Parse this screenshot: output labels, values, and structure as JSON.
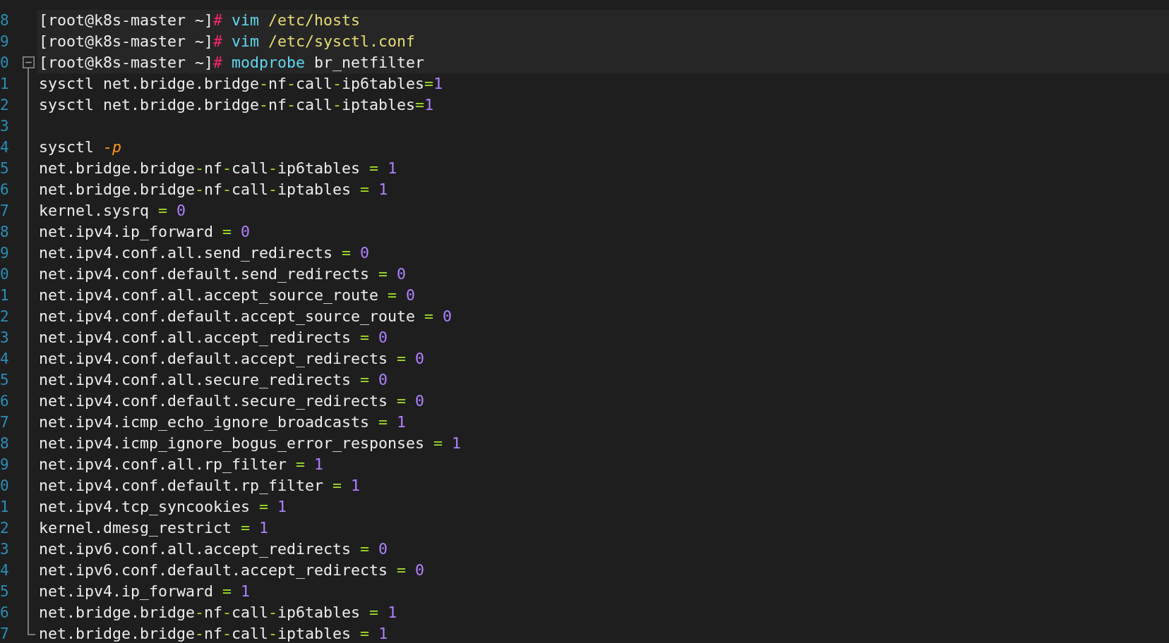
{
  "editor": {
    "lines": [
      {
        "number": "8",
        "highlighted": true,
        "segments": [
          {
            "kind": "plain",
            "text": "[root@k8s-master ~]"
          },
          {
            "kind": "prompt",
            "text": "#"
          },
          {
            "kind": "command",
            "text": " vim"
          },
          {
            "kind": "path",
            "text": " /etc/hosts"
          }
        ]
      },
      {
        "number": "9",
        "highlighted": true,
        "segments": [
          {
            "kind": "plain",
            "text": "[root@k8s-master ~]"
          },
          {
            "kind": "prompt",
            "text": "#"
          },
          {
            "kind": "command",
            "text": " vim"
          },
          {
            "kind": "path",
            "text": " /etc/sysctl.conf"
          }
        ]
      },
      {
        "number": "0",
        "highlighted": true,
        "expanded": true,
        "segments": [
          {
            "kind": "plain",
            "text": "[root@k8s-master ~]"
          },
          {
            "kind": "prompt",
            "text": "#"
          },
          {
            "kind": "command",
            "text": " modprobe"
          },
          {
            "kind": "plain",
            "text": " br_netfilter"
          }
        ],
        "children": [
          {
            "number": "1",
            "highlighted": false,
            "segments": [
              {
                "kind": "plain",
                "text": "sysctl net.bridge.bridge"
              },
              {
                "kind": "operator",
                "text": "-"
              },
              {
                "kind": "plain",
                "text": "nf"
              },
              {
                "kind": "operator",
                "text": "-"
              },
              {
                "kind": "plain",
                "text": "call"
              },
              {
                "kind": "operator",
                "text": "-"
              },
              {
                "kind": "plain",
                "text": "ip6tables"
              },
              {
                "kind": "operator",
                "text": "="
              },
              {
                "kind": "number",
                "text": "1"
              }
            ]
          },
          {
            "number": "2",
            "highlighted": false,
            "segments": [
              {
                "kind": "plain",
                "text": "sysctl net.bridge.bridge"
              },
              {
                "kind": "operator",
                "text": "-"
              },
              {
                "kind": "plain",
                "text": "nf"
              },
              {
                "kind": "operator",
                "text": "-"
              },
              {
                "kind": "plain",
                "text": "call"
              },
              {
                "kind": "operator",
                "text": "-"
              },
              {
                "kind": "plain",
                "text": "iptables"
              },
              {
                "kind": "operator",
                "text": "="
              },
              {
                "kind": "number",
                "text": "1"
              }
            ]
          },
          {
            "number": "3",
            "highlighted": false
          },
          {
            "number": "4",
            "highlighted": false,
            "segments": [
              {
                "kind": "plain",
                "text": "sysctl "
              },
              {
                "kind": "flag",
                "text": "-p"
              }
            ]
          },
          {
            "number": "5",
            "highlighted": false,
            "segments": [
              {
                "kind": "plain",
                "text": "net.bridge.bridge"
              },
              {
                "kind": "operator",
                "text": "-"
              },
              {
                "kind": "plain",
                "text": "nf"
              },
              {
                "kind": "operator",
                "text": "-"
              },
              {
                "kind": "plain",
                "text": "call"
              },
              {
                "kind": "operator",
                "text": "-"
              },
              {
                "kind": "plain",
                "text": "ip6tables "
              },
              {
                "kind": "operator",
                "text": "="
              },
              {
                "kind": "number",
                "text": " 1"
              }
            ]
          },
          {
            "number": "6",
            "highlighted": false,
            "segments": [
              {
                "kind": "plain",
                "text": "net.bridge.bridge"
              },
              {
                "kind": "operator",
                "text": "-"
              },
              {
                "kind": "plain",
                "text": "nf"
              },
              {
                "kind": "operator",
                "text": "-"
              },
              {
                "kind": "plain",
                "text": "call"
              },
              {
                "kind": "operator",
                "text": "-"
              },
              {
                "kind": "plain",
                "text": "iptables "
              },
              {
                "kind": "operator",
                "text": "="
              },
              {
                "kind": "number",
                "text": " 1"
              }
            ]
          },
          {
            "number": "7",
            "highlighted": false,
            "segments": [
              {
                "kind": "plain",
                "text": "kernel.sysrq "
              },
              {
                "kind": "operator",
                "text": "="
              },
              {
                "kind": "number",
                "text": " 0"
              }
            ]
          },
          {
            "number": "8",
            "highlighted": false,
            "segments": [
              {
                "kind": "plain",
                "text": "net.ipv4.ip_forward "
              },
              {
                "kind": "operator",
                "text": "="
              },
              {
                "kind": "number",
                "text": " 0"
              }
            ]
          },
          {
            "number": "9",
            "highlighted": false,
            "segments": [
              {
                "kind": "plain",
                "text": "net.ipv4.conf.all.send_redirects "
              },
              {
                "kind": "operator",
                "text": "="
              },
              {
                "kind": "number",
                "text": " 0"
              }
            ]
          },
          {
            "number": "0",
            "highlighted": false,
            "segments": [
              {
                "kind": "plain",
                "text": "net.ipv4.conf.default.send_redirects "
              },
              {
                "kind": "operator",
                "text": "="
              },
              {
                "kind": "number",
                "text": " 0"
              }
            ]
          },
          {
            "number": "1",
            "highlighted": false,
            "segments": [
              {
                "kind": "plain",
                "text": "net.ipv4.conf.all.accept_source_route "
              },
              {
                "kind": "operator",
                "text": "="
              },
              {
                "kind": "number",
                "text": " 0"
              }
            ]
          },
          {
            "number": "2",
            "highlighted": false,
            "segments": [
              {
                "kind": "plain",
                "text": "net.ipv4.conf.default.accept_source_route "
              },
              {
                "kind": "operator",
                "text": "="
              },
              {
                "kind": "number",
                "text": " 0"
              }
            ]
          },
          {
            "number": "3",
            "highlighted": false,
            "segments": [
              {
                "kind": "plain",
                "text": "net.ipv4.conf.all.accept_redirects "
              },
              {
                "kind": "operator",
                "text": "="
              },
              {
                "kind": "number",
                "text": " 0"
              }
            ]
          },
          {
            "number": "4",
            "highlighted": false,
            "segments": [
              {
                "kind": "plain",
                "text": "net.ipv4.conf.default.accept_redirects "
              },
              {
                "kind": "operator",
                "text": "="
              },
              {
                "kind": "number",
                "text": " 0"
              }
            ]
          },
          {
            "number": "5",
            "highlighted": false,
            "segments": [
              {
                "kind": "plain",
                "text": "net.ipv4.conf.all.secure_redirects "
              },
              {
                "kind": "operator",
                "text": "="
              },
              {
                "kind": "number",
                "text": " 0"
              }
            ]
          },
          {
            "number": "6",
            "highlighted": false,
            "segments": [
              {
                "kind": "plain",
                "text": "net.ipv4.conf.default.secure_redirects "
              },
              {
                "kind": "operator",
                "text": "="
              },
              {
                "kind": "number",
                "text": " 0"
              }
            ]
          },
          {
            "number": "7",
            "highlighted": false,
            "segments": [
              {
                "kind": "plain",
                "text": "net.ipv4.icmp_echo_ignore_broadcasts "
              },
              {
                "kind": "operator",
                "text": "="
              },
              {
                "kind": "number",
                "text": " 1"
              }
            ]
          },
          {
            "number": "8",
            "highlighted": false,
            "segments": [
              {
                "kind": "plain",
                "text": "net.ipv4.icmp_ignore_bogus_error_responses "
              },
              {
                "kind": "operator",
                "text": "="
              },
              {
                "kind": "number",
                "text": " 1"
              }
            ]
          },
          {
            "number": "9",
            "highlighted": false,
            "segments": [
              {
                "kind": "plain",
                "text": "net.ipv4.conf.all.rp_filter "
              },
              {
                "kind": "operator",
                "text": "="
              },
              {
                "kind": "number",
                "text": " 1"
              }
            ]
          },
          {
            "number": "0",
            "highlighted": false,
            "segments": [
              {
                "kind": "plain",
                "text": "net.ipv4.conf.default.rp_filter "
              },
              {
                "kind": "operator",
                "text": "="
              },
              {
                "kind": "number",
                "text": " 1"
              }
            ]
          },
          {
            "number": "1",
            "highlighted": false,
            "segments": [
              {
                "kind": "plain",
                "text": "net.ipv4.tcp_syncookies "
              },
              {
                "kind": "operator",
                "text": "="
              },
              {
                "kind": "number",
                "text": " 1"
              }
            ]
          },
          {
            "number": "2",
            "highlighted": false,
            "segments": [
              {
                "kind": "plain",
                "text": "kernel.dmesg_restrict "
              },
              {
                "kind": "operator",
                "text": "="
              },
              {
                "kind": "number",
                "text": " 1"
              }
            ]
          },
          {
            "number": "3",
            "highlighted": false,
            "segments": [
              {
                "kind": "plain",
                "text": "net.ipv6.conf.all.accept_redirects "
              },
              {
                "kind": "operator",
                "text": "="
              },
              {
                "kind": "number",
                "text": " 0"
              }
            ]
          },
          {
            "number": "4",
            "highlighted": false,
            "segments": [
              {
                "kind": "plain",
                "text": "net.ipv6.conf.default.accept_redirects "
              },
              {
                "kind": "operator",
                "text": "="
              },
              {
                "kind": "number",
                "text": " 0"
              }
            ]
          },
          {
            "number": "5",
            "highlighted": false,
            "segments": [
              {
                "kind": "plain",
                "text": "net.ipv4.ip_forward "
              },
              {
                "kind": "operator",
                "text": "="
              },
              {
                "kind": "number",
                "text": " 1"
              }
            ]
          },
          {
            "number": "6",
            "highlighted": false,
            "segments": [
              {
                "kind": "plain",
                "text": "net.bridge.bridge"
              },
              {
                "kind": "operator",
                "text": "-"
              },
              {
                "kind": "plain",
                "text": "nf"
              },
              {
                "kind": "operator",
                "text": "-"
              },
              {
                "kind": "plain",
                "text": "call"
              },
              {
                "kind": "operator",
                "text": "-"
              },
              {
                "kind": "plain",
                "text": "ip6tables "
              },
              {
                "kind": "operator",
                "text": "="
              },
              {
                "kind": "number",
                "text": " 1"
              }
            ]
          },
          {
            "number": "7",
            "highlighted": false,
            "segments": [
              {
                "kind": "plain",
                "text": "net.bridge.bridge"
              },
              {
                "kind": "operator",
                "text": "-"
              },
              {
                "kind": "plain",
                "text": "nf"
              },
              {
                "kind": "operator",
                "text": "-"
              },
              {
                "kind": "plain",
                "text": "call"
              },
              {
                "kind": "operator",
                "text": "-"
              },
              {
                "kind": "plain",
                "text": "iptables "
              },
              {
                "kind": "operator",
                "text": "="
              },
              {
                "kind": "number",
                "text": " 1"
              }
            ]
          }
        ]
      }
    ]
  }
}
